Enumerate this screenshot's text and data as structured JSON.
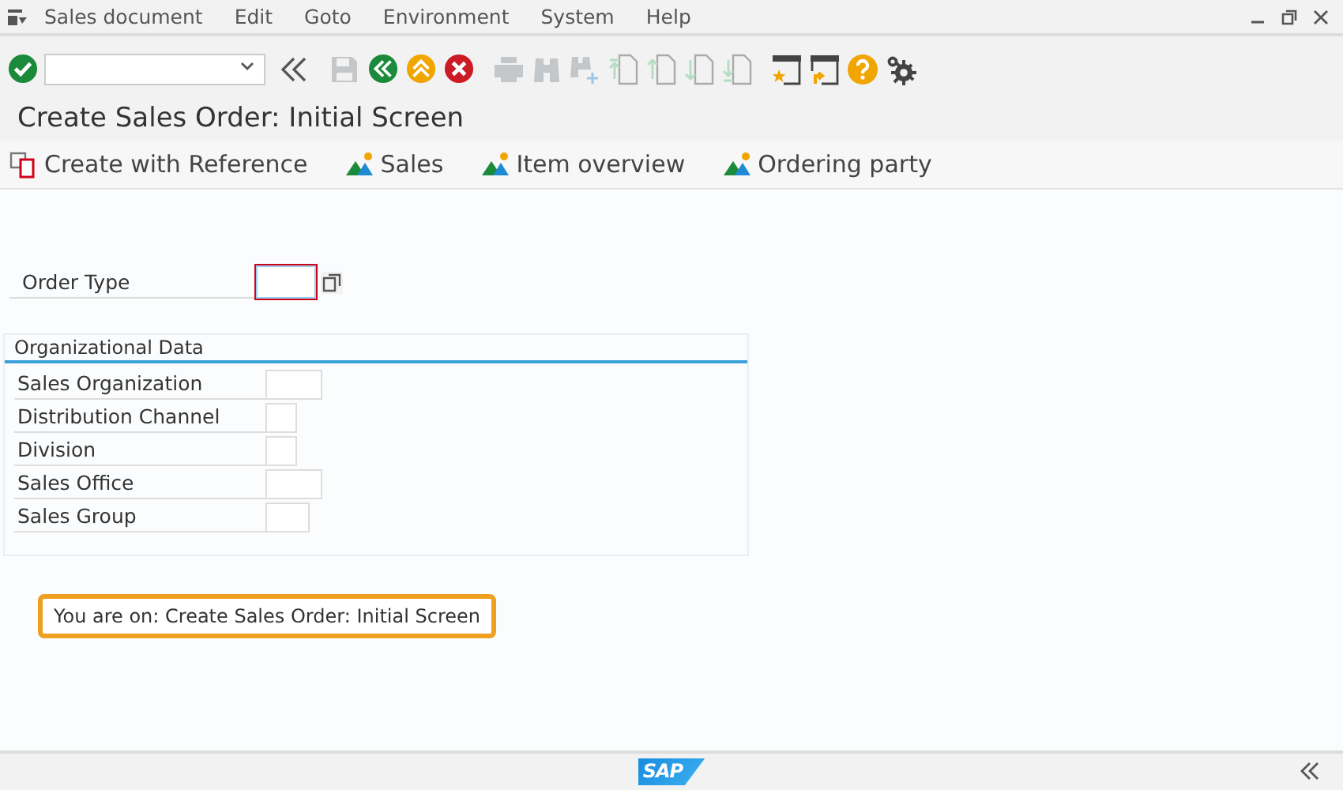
{
  "menu": [
    "Sales document",
    "Edit",
    "Goto",
    "Environment",
    "System",
    "Help"
  ],
  "toolbar": [
    {
      "kind": "check",
      "disabled": false
    },
    {
      "kind": "command-field",
      "disabled": false
    },
    {
      "kind": "collapse",
      "disabled": false
    },
    {
      "kind": "save",
      "disabled": true
    },
    {
      "kind": "back",
      "disabled": false
    },
    {
      "kind": "exit",
      "disabled": false
    },
    {
      "kind": "cancel",
      "disabled": false
    },
    {
      "kind": "print",
      "disabled": true
    },
    {
      "kind": "find",
      "disabled": true
    },
    {
      "kind": "find-next",
      "disabled": true
    },
    {
      "kind": "first-page",
      "disabled": true
    },
    {
      "kind": "prev-page",
      "disabled": true
    },
    {
      "kind": "next-page",
      "disabled": true
    },
    {
      "kind": "last-page",
      "disabled": true
    },
    {
      "kind": "new-session",
      "disabled": false
    },
    {
      "kind": "shortcut",
      "disabled": false
    },
    {
      "kind": "help",
      "disabled": false
    },
    {
      "kind": "settings",
      "disabled": false
    }
  ],
  "title": "Create Sales Order: Initial Screen",
  "app_toolbar": [
    {
      "kind": "copy",
      "label": "Create with Reference"
    },
    {
      "kind": "overview",
      "label": "Sales"
    },
    {
      "kind": "overview",
      "label": "Item overview"
    },
    {
      "kind": "overview",
      "label": "Ordering party"
    }
  ],
  "order_type": {
    "label": "Order Type",
    "required": true
  },
  "org_data": {
    "title": "Organizational Data",
    "fields": [
      {
        "label": "Sales Organization"
      },
      {
        "label": "Distribution Channel"
      },
      {
        "label": "Division"
      },
      {
        "label": "Sales Office"
      },
      {
        "label": "Sales Group"
      }
    ]
  },
  "callout": "You are on: Create Sales Order: Initial Screen",
  "footer": {
    "logo": "SAP"
  }
}
